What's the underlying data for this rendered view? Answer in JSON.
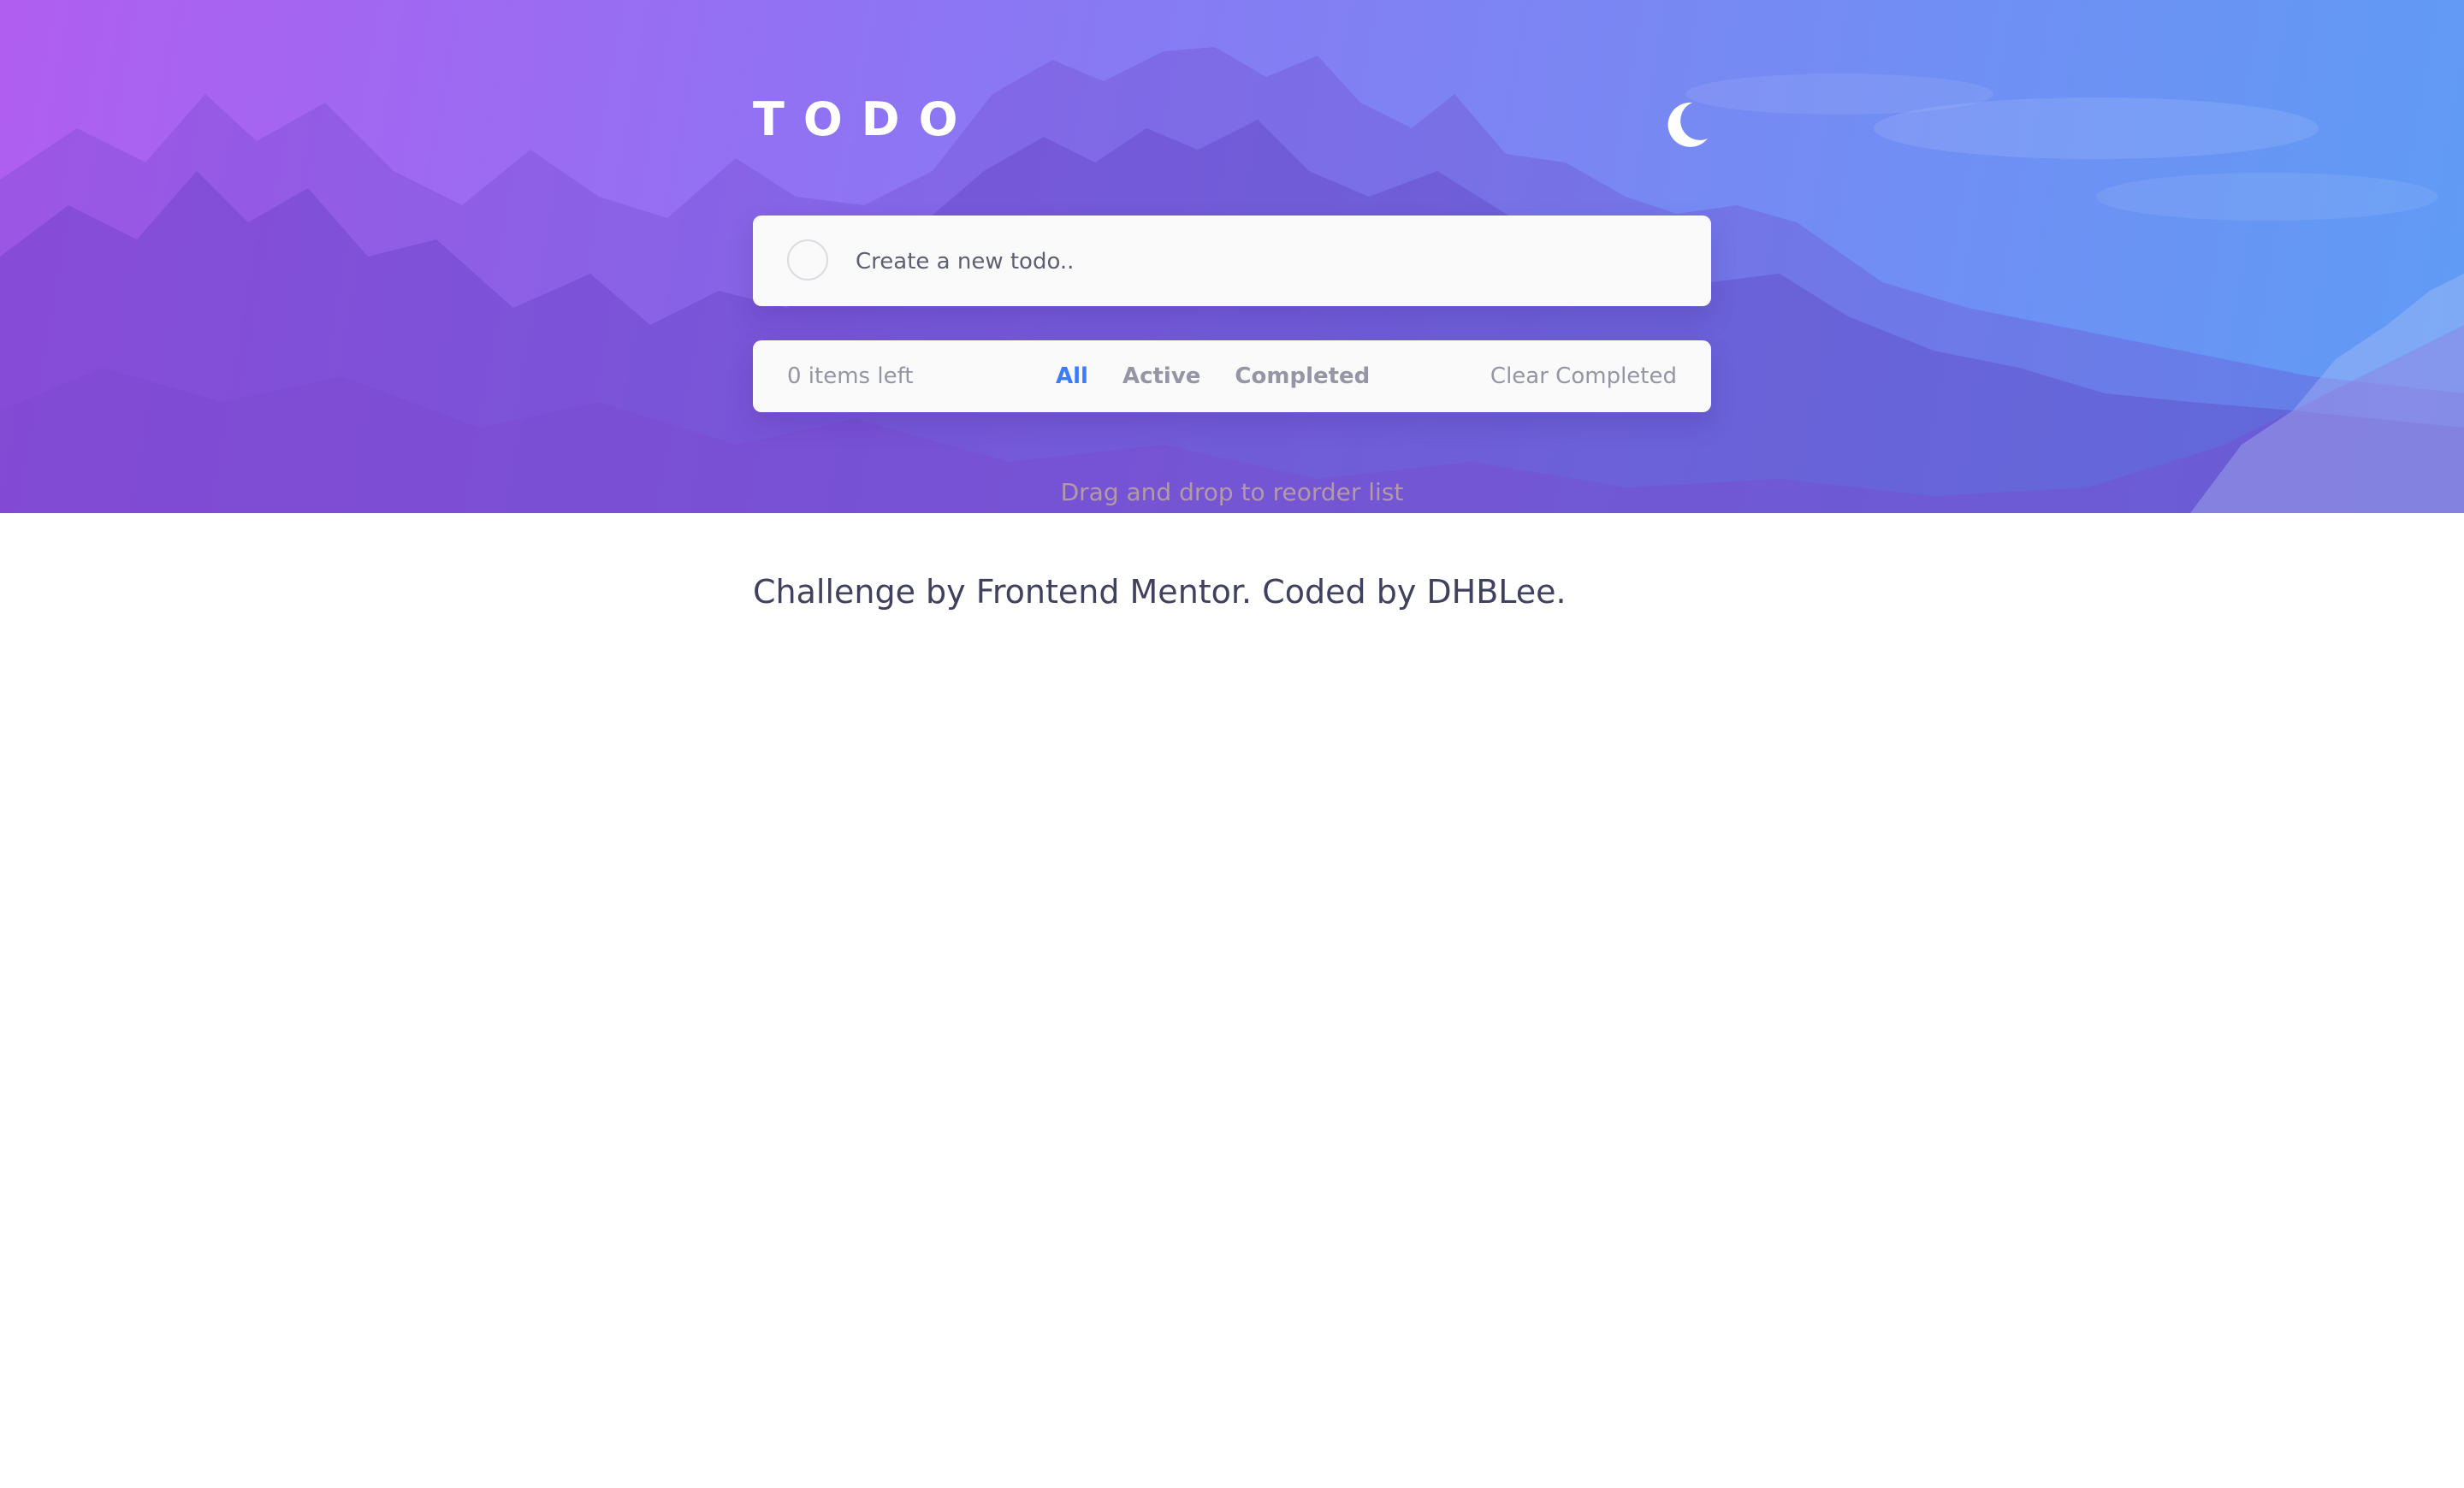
{
  "app": {
    "title": "TODO",
    "theme_icon": "moon-icon"
  },
  "new_todo": {
    "placeholder": "Create a new todo..",
    "value": ""
  },
  "footer": {
    "items_left": "0 items left",
    "filters": [
      {
        "label": "All",
        "active": true
      },
      {
        "label": "Active",
        "active": false
      },
      {
        "label": "Completed",
        "active": false
      }
    ],
    "clear_label": "Clear Completed"
  },
  "drag_hint": "Drag and drop to reorder list",
  "attribution": "Challenge by Frontend Mentor. Coded by DHBLee.",
  "colors": {
    "accent": "#3a7cfd",
    "gradient_start": "#b05ef0",
    "gradient_end": "#5f9cf5",
    "card_bg": "#fafafa",
    "muted_text": "#9495a5",
    "attribution_text": "#3f415e"
  }
}
